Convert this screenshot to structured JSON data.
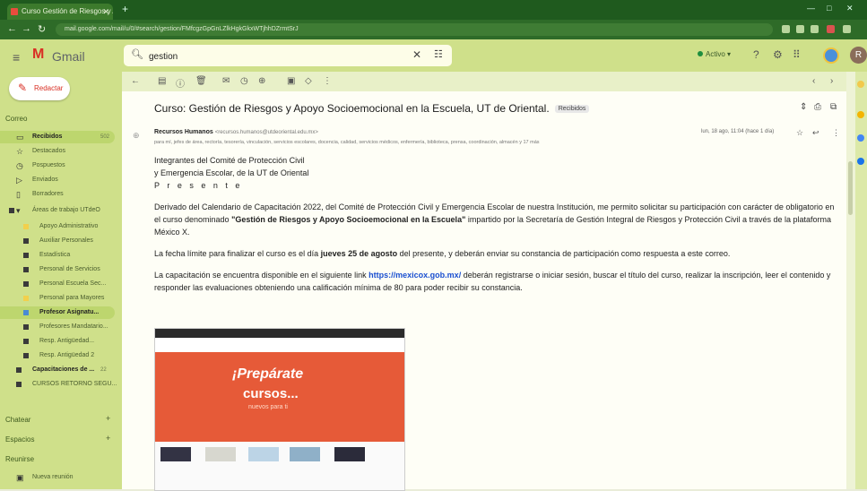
{
  "browser": {
    "tab_title": "Curso Gestión de Riesgos y Apo...",
    "url": "mail.google.com/mail/u/0/#search/gestion/FMfcgzGpGnLZlkHgkGkxWTjhhDZrmtSrJ"
  },
  "gmail": {
    "brand": "Gmail",
    "compose_label": "Redactar",
    "search_value": "gestion",
    "status_label": "Activo"
  },
  "sidebar": {
    "section_mail": "Correo",
    "items": [
      {
        "label": "Recibidos",
        "count": "502"
      },
      {
        "label": "Destacados"
      },
      {
        "label": "Pospuestos"
      },
      {
        "label": "Enviados"
      },
      {
        "label": "Borradores"
      },
      {
        "label": "Áreas de trabajo UTdeO"
      },
      {
        "label": "Apoyo Administrativo"
      },
      {
        "label": "Auxiliar Personales"
      },
      {
        "label": "Estadística"
      },
      {
        "label": "Personal de Servicios"
      },
      {
        "label": "Personal Escuela Sec..."
      },
      {
        "label": "Personal para Mayores"
      },
      {
        "label": "Profesor Asignatu..."
      },
      {
        "label": "Profesores Mandatario..."
      },
      {
        "label": "Resp. Antigüedad..."
      },
      {
        "label": "Resp. Antigüedad 2"
      },
      {
        "label": "Capacitaciones de ...",
        "count": "22"
      },
      {
        "label": "CURSOS RETORNO SEGU..."
      }
    ],
    "section_chat": "Chatear",
    "section_spaces": "Espacios",
    "section_meet": "Reunirse",
    "meet_item": "Nueva reunión"
  },
  "email": {
    "subject": "Curso: Gestión de Riesgos y Apoyo Socioemocional en la Escuela, UT de Oriental.",
    "label_badge": "Recibidos",
    "sender_name": "Recursos Humanos",
    "sender_email": "<recursos.humanos@utdeoriental.edu.mx>",
    "to_line": "para mí, jefes de área, rectoría, tesorería, vinculación, servicios escolares, docencia, calidad, servicios médicos, enfermería, biblioteca, prensa, coordinación, almacén y 17 más",
    "date": "lun, 18 ago, 11:04 (hace 1 día)",
    "greeting_1": "Integrantes del Comité de Protección Civil",
    "greeting_2": "y Emergencia Escolar, de la UT de Oriental",
    "greeting_3": "P r e s e n t e",
    "p1_a": "Derivado del Calendario de Capacitación 2022, del Comité de Protección Civil y Emergencia Escolar de nuestra Institución, me permito solicitar su participación con carácter de obligatorio en el curso denominado ",
    "p1_bold": "\"Gestión de Riesgos y Apoyo Socioemocional en la Escuela\"",
    "p1_b": " impartido por la Secretaría de Gestión Integral de Riesgos y Protección Civil a través de la plataforma México X.",
    "p2_a": "La fecha límite para finalizar el curso es el día ",
    "p2_bold": "jueves 25 de agosto",
    "p2_b": " del presente, y deberán enviar su constancia de participación como respuesta a este correo.",
    "p3_a": "La capacitación se encuentra disponible en el siguiente link ",
    "p3_link": "https://mexicox.gob.mx/",
    "p3_b": " deberán registrarse o iniciar sesión, buscar el título del curso, realizar la inscripción, leer el contenido y responder las evaluaciones obteniendo una calificación mínima de 80 para poder recibir su constancia."
  },
  "banner": {
    "line1": "¡Prepárate",
    "line2": "cursos...",
    "line3": "nuevos para ti"
  },
  "colors": {
    "theme_green": "#cfe08a",
    "chrome_green": "#2e6b28",
    "banner_orange": "#e65a38",
    "link_blue": "#1a4fd0"
  }
}
